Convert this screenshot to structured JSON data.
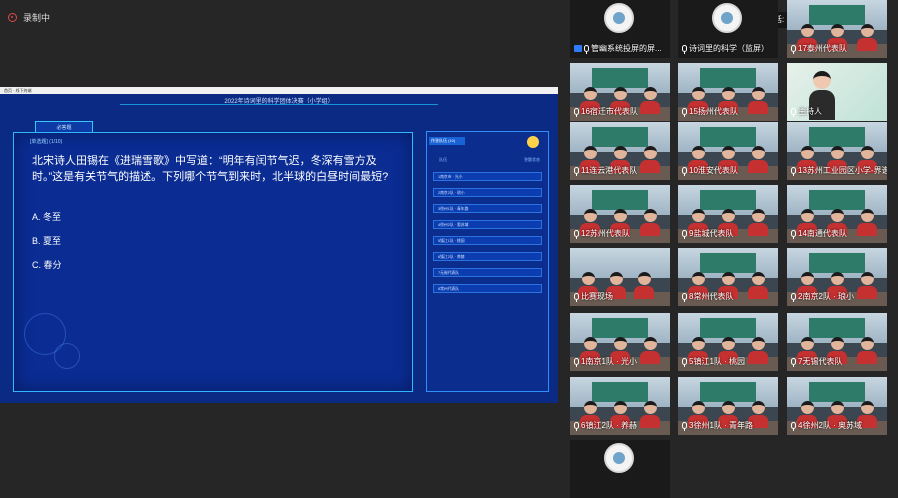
{
  "recording": {
    "label": "录制中"
  },
  "speaking_banner": {
    "text": "正在讲话: 主持人;"
  },
  "screen": {
    "window_title": "首页 · 线下终端",
    "title": "2022年诗词里的科学团体决赛（小学组）",
    "tab_label": "必答题",
    "question_tag": "[单选题]   (1/10)",
    "question": "北宋诗人田锡在《进瑞雪歌》中写道：“明年有闰节气迟，冬深有雪方及时。”这是有关节气的描述。下列哪个节气到来时，北半球的白昼时间最短?",
    "options": [
      "A. 冬至",
      "B. 夏至",
      "C. 春分"
    ],
    "side": {
      "header": "作答队伍 (10)",
      "col_left": "队伍",
      "col_right": "答题状态",
      "rows": [
        "1南京市 · 光小",
        "2南京2队 · 琅小",
        "3徐州1队 · 青年路",
        "4徐州2队 · 奥苏域",
        "5镇江1队 · 桃园",
        "6镇江2队 · 养赫",
        "7无锡代表队",
        "8常州代表队"
      ]
    }
  },
  "participants": [
    {
      "name": "管幽系统投屏的屏...",
      "type": "avatar",
      "icons": true
    },
    {
      "name": "诗词里的科学（监屏）",
      "type": "avatar"
    },
    {
      "name": "17泰州代表队",
      "type": "class"
    },
    {
      "name": "16宿迁市代表队",
      "type": "class"
    },
    {
      "name": "15扬州代表队",
      "type": "class"
    },
    {
      "name": "主持人",
      "type": "host"
    },
    {
      "name": "11连云港代表队",
      "type": "class"
    },
    {
      "name": "10淮安代表队",
      "type": "class"
    },
    {
      "name": "13苏州工业园区小学-界谱",
      "type": "class"
    },
    {
      "name": "12苏州代表队",
      "type": "class"
    },
    {
      "name": "9盐城代表队",
      "type": "class"
    },
    {
      "name": "14南通代表队",
      "type": "class"
    },
    {
      "name": "比赛现场",
      "type": "hall"
    },
    {
      "name": "8常州代表队",
      "type": "class"
    },
    {
      "name": "2南京2队 · 琅小",
      "type": "class"
    },
    {
      "name": "1南京1队 · 光小",
      "type": "class"
    },
    {
      "name": "5镇江1队 · 桃园",
      "type": "class"
    },
    {
      "name": "7无锡代表队",
      "type": "class"
    },
    {
      "name": "6镇江2队 · 养赫",
      "type": "class"
    },
    {
      "name": "3徐州1队 · 青年路",
      "type": "class"
    },
    {
      "name": "4徐州2队 · 奥苏域",
      "type": "class"
    },
    {
      "name": "",
      "type": "avatar"
    }
  ],
  "colors": {
    "screen_bg": "#0b2a83",
    "accent": "#2fb8ff",
    "record_red": "#e04848"
  }
}
